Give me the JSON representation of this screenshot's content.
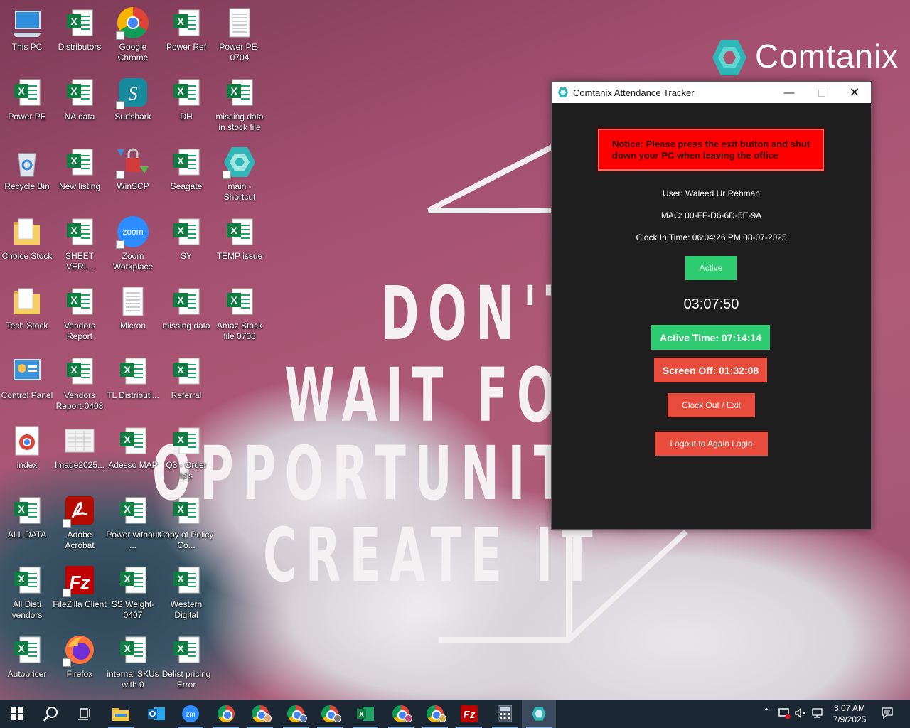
{
  "wallpaper": {
    "brand": "Comtanix",
    "quote": [
      "DON'T",
      "WAIT FOR",
      "OPPORTUNITY",
      "CREATE IT"
    ]
  },
  "desktop_icons": [
    {
      "label": "This PC",
      "icon": "computer-icon",
      "col": 0,
      "row": 0
    },
    {
      "label": "Power PE",
      "icon": "excel-icon",
      "col": 0,
      "row": 1
    },
    {
      "label": "Recycle Bin",
      "icon": "recycle-bin-icon",
      "col": 0,
      "row": 2
    },
    {
      "label": "Choice Stock",
      "icon": "folder-icon",
      "col": 0,
      "row": 3
    },
    {
      "label": "Tech Stock",
      "icon": "folder-icon",
      "col": 0,
      "row": 4
    },
    {
      "label": "Control Panel",
      "icon": "control-panel-icon",
      "col": 0,
      "row": 5
    },
    {
      "label": "index",
      "icon": "chrome-html-icon",
      "col": 0,
      "row": 6
    },
    {
      "label": "ALL DATA",
      "icon": "excel-icon",
      "col": 0,
      "row": 7
    },
    {
      "label": "All Disti vendors",
      "icon": "excel-icon",
      "col": 0,
      "row": 8
    },
    {
      "label": "Autopricer",
      "icon": "excel-icon",
      "col": 0,
      "row": 9
    },
    {
      "label": "Distributors",
      "icon": "excel-icon",
      "col": 1,
      "row": 0
    },
    {
      "label": "NA data",
      "icon": "excel-icon",
      "col": 1,
      "row": 1
    },
    {
      "label": "New listing",
      "icon": "excel-icon",
      "col": 1,
      "row": 2
    },
    {
      "label": "SHEET VERI...",
      "icon": "excel-icon",
      "col": 1,
      "row": 3
    },
    {
      "label": "Vendors Report",
      "icon": "excel-icon",
      "col": 1,
      "row": 4
    },
    {
      "label": "Vendors Report-0408",
      "icon": "excel-icon",
      "col": 1,
      "row": 5
    },
    {
      "label": "Image2025...",
      "icon": "image-file-icon",
      "col": 1,
      "row": 6
    },
    {
      "label": "Adobe Acrobat",
      "icon": "acrobat-icon",
      "col": 1,
      "row": 7
    },
    {
      "label": "FileZilla Client",
      "icon": "filezilla-icon",
      "col": 1,
      "row": 8
    },
    {
      "label": "Firefox",
      "icon": "firefox-icon",
      "col": 1,
      "row": 9
    },
    {
      "label": "Google Chrome",
      "icon": "chrome-icon",
      "col": 2,
      "row": 0
    },
    {
      "label": "Surfshark",
      "icon": "surfshark-icon",
      "col": 2,
      "row": 1
    },
    {
      "label": "WinSCP",
      "icon": "winscp-icon",
      "col": 2,
      "row": 2
    },
    {
      "label": "Zoom Workplace",
      "icon": "zoom-icon",
      "col": 2,
      "row": 3
    },
    {
      "label": "Micron",
      "icon": "text-file-icon",
      "col": 2,
      "row": 4
    },
    {
      "label": "TL Distributi...",
      "icon": "excel-icon",
      "col": 2,
      "row": 5
    },
    {
      "label": "Adesso MAP",
      "icon": "excel-icon",
      "col": 2,
      "row": 6
    },
    {
      "label": "Power without ...",
      "icon": "excel-icon",
      "col": 2,
      "row": 7
    },
    {
      "label": "SS Weight-0407",
      "icon": "excel-icon",
      "col": 2,
      "row": 8
    },
    {
      "label": "internal SKUs with 0",
      "icon": "excel-icon",
      "col": 2,
      "row": 9
    },
    {
      "label": "Power Ref",
      "icon": "excel-icon",
      "col": 3,
      "row": 0
    },
    {
      "label": "DH",
      "icon": "excel-icon",
      "col": 3,
      "row": 1
    },
    {
      "label": "Seagate",
      "icon": "excel-icon",
      "col": 3,
      "row": 2
    },
    {
      "label": "SY",
      "icon": "excel-icon",
      "col": 3,
      "row": 3
    },
    {
      "label": "missing data",
      "icon": "excel-icon",
      "col": 3,
      "row": 4
    },
    {
      "label": "Referral",
      "icon": "excel-icon",
      "col": 3,
      "row": 5
    },
    {
      "label": "Q3 - Order Id's",
      "icon": "excel-icon",
      "col": 3,
      "row": 6
    },
    {
      "label": "Copy of Policy Co...",
      "icon": "excel-icon",
      "col": 3,
      "row": 7
    },
    {
      "label": "Western Digital",
      "icon": "excel-icon",
      "col": 3,
      "row": 8
    },
    {
      "label": "Delist pricing Error",
      "icon": "excel-icon",
      "col": 3,
      "row": 9
    },
    {
      "label": "Power PE-0704",
      "icon": "text-file-icon",
      "col": 4,
      "row": 0
    },
    {
      "label": "missing data in stock file",
      "icon": "excel-icon",
      "col": 4,
      "row": 1
    },
    {
      "label": "main - Shortcut",
      "icon": "comtanix-icon",
      "col": 4,
      "row": 2
    },
    {
      "label": "TEMP issue",
      "icon": "excel-icon",
      "col": 4,
      "row": 3
    },
    {
      "label": "Amaz Stock file 0708",
      "icon": "excel-icon",
      "col": 4,
      "row": 4
    }
  ],
  "app": {
    "title": "Comtanix Attendance Tracker",
    "notice": "Notice: Please press the exit button and shut down your PC when leaving the office",
    "user": "User: Waleed Ur  Rehman",
    "mac": "MAC: 00-FF-D6-6D-5E-9A",
    "clock_in": "Clock In Time: 06:04:26 PM 08-07-2025",
    "status": "Active",
    "timer": "03:07:50",
    "active_time": "Active Time: 07:14:14",
    "screen_off": "Screen Off: 01:32:08",
    "clock_out_label": "Clock Out / Exit",
    "logout_label": "Logout to Again Login",
    "colors": {
      "active": "#2ecc71",
      "danger": "#e74c3c",
      "notice": "#ff0000"
    }
  },
  "taskbar": {
    "time": "3:07 AM",
    "date": "7/9/2025"
  }
}
